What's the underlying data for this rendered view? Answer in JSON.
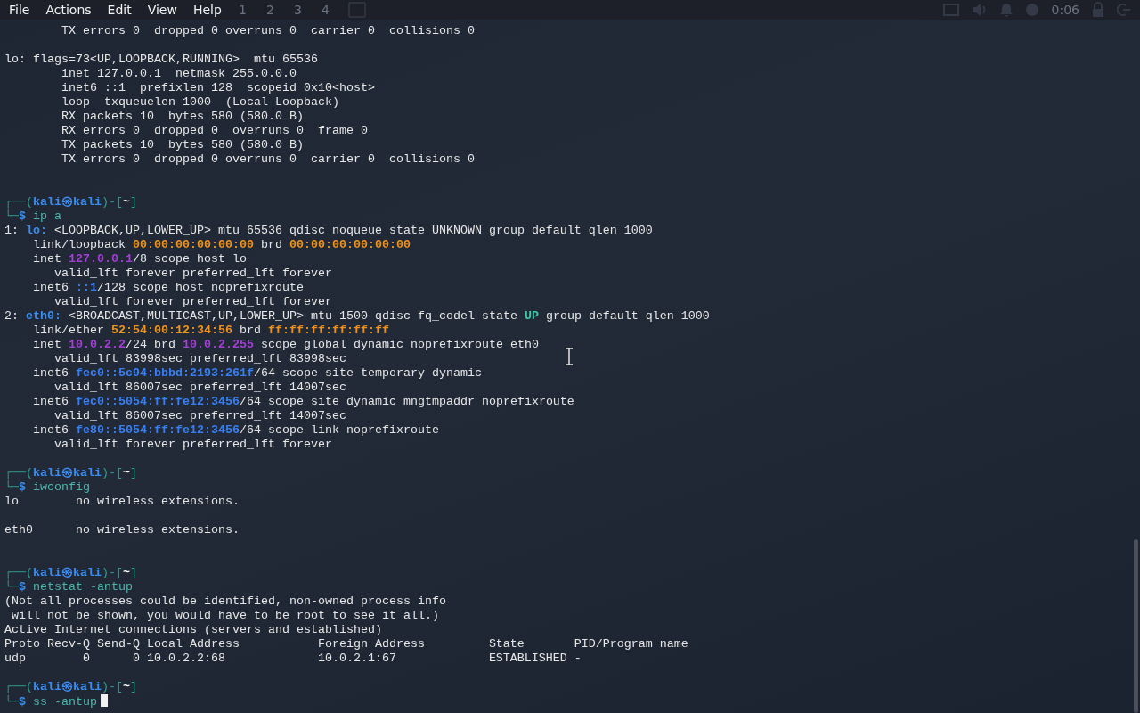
{
  "menu": [
    "File",
    "Actions",
    "Edit",
    "View",
    "Help"
  ],
  "panel": {
    "workspaces": [
      "1",
      "2",
      "3",
      "4"
    ],
    "clock": "0:06"
  },
  "terminal": {
    "lines": [
      {
        "segments": [
          {
            "kind": "plain",
            "text": "        TX errors 0  dropped 0 overruns 0  carrier 0  collisions 0"
          }
        ]
      },
      {
        "kind": "blank"
      },
      {
        "segments": [
          {
            "kind": "plain",
            "text": "lo: flags=73<UP,LOOPBACK,RUNNING>  mtu 65536"
          }
        ]
      },
      {
        "segments": [
          {
            "kind": "plain",
            "text": "        inet 127.0.0.1  netmask 255.0.0.0"
          }
        ]
      },
      {
        "segments": [
          {
            "kind": "plain",
            "text": "        inet6 ::1  prefixlen 128  scopeid 0x10<host>"
          }
        ]
      },
      {
        "segments": [
          {
            "kind": "plain",
            "text": "        loop  txqueuelen 1000  (Local Loopback)"
          }
        ]
      },
      {
        "segments": [
          {
            "kind": "plain",
            "text": "        RX packets 10  bytes 580 (580.0 B)"
          }
        ]
      },
      {
        "segments": [
          {
            "kind": "plain",
            "text": "        RX errors 0  dropped 0  overruns 0  frame 0"
          }
        ]
      },
      {
        "segments": [
          {
            "kind": "plain",
            "text": "        TX packets 10  bytes 580 (580.0 B)"
          }
        ]
      },
      {
        "segments": [
          {
            "kind": "plain",
            "text": "        TX errors 0  dropped 0 overruns 0  carrier 0  collisions 0"
          }
        ]
      },
      {
        "kind": "blank"
      },
      {
        "kind": "blank"
      },
      {
        "segments": [
          {
            "kind": "frame",
            "text": "┌──("
          },
          {
            "kind": "user",
            "text": "kali㉿kali"
          },
          {
            "kind": "frame",
            "text": ")-["
          },
          {
            "kind": "dir",
            "text": "~"
          },
          {
            "kind": "frame",
            "text": "]"
          }
        ]
      },
      {
        "segments": [
          {
            "kind": "frame",
            "text": "└─"
          },
          {
            "kind": "user",
            "text": "$"
          },
          {
            "kind": "command",
            "text": " ip a"
          }
        ]
      },
      {
        "segments": [
          {
            "kind": "plain",
            "text": "1: "
          },
          {
            "kind": "iface",
            "text": "lo:"
          },
          {
            "kind": "plain",
            "text": " <LOOPBACK,UP,LOWER_UP> mtu 65536 qdisc noqueue state UNKNOWN group default qlen 1000"
          }
        ]
      },
      {
        "segments": [
          {
            "kind": "plain",
            "text": "    link/loopback "
          },
          {
            "kind": "mac",
            "text": "00:00:00:00:00:00"
          },
          {
            "kind": "plain",
            "text": " brd "
          },
          {
            "kind": "mac",
            "text": "00:00:00:00:00:00"
          }
        ]
      },
      {
        "segments": [
          {
            "kind": "plain",
            "text": "    inet "
          },
          {
            "kind": "ipv4",
            "text": "127.0.0.1"
          },
          {
            "kind": "plain",
            "text": "/8 scope host lo"
          }
        ]
      },
      {
        "segments": [
          {
            "kind": "plain",
            "text": "       valid_lft forever preferred_lft forever"
          }
        ]
      },
      {
        "segments": [
          {
            "kind": "plain",
            "text": "    inet6 "
          },
          {
            "kind": "ipv6",
            "text": "::1"
          },
          {
            "kind": "plain",
            "text": "/128 scope host noprefixroute"
          }
        ]
      },
      {
        "segments": [
          {
            "kind": "plain",
            "text": "       valid_lft forever preferred_lft forever"
          }
        ]
      },
      {
        "segments": [
          {
            "kind": "plain",
            "text": "2: "
          },
          {
            "kind": "iface",
            "text": "eth0:"
          },
          {
            "kind": "plain",
            "text": " <BROADCAST,MULTICAST,UP,LOWER_UP> mtu 1500 qdisc fq_codel state "
          },
          {
            "kind": "up",
            "text": "UP"
          },
          {
            "kind": "plain",
            "text": " group default qlen 1000"
          }
        ]
      },
      {
        "segments": [
          {
            "kind": "plain",
            "text": "    link/ether "
          },
          {
            "kind": "mac",
            "text": "52:54:00:12:34:56"
          },
          {
            "kind": "plain",
            "text": " brd "
          },
          {
            "kind": "mac",
            "text": "ff:ff:ff:ff:ff:ff"
          }
        ]
      },
      {
        "segments": [
          {
            "kind": "plain",
            "text": "    inet "
          },
          {
            "kind": "ipv4",
            "text": "10.0.2.2"
          },
          {
            "kind": "plain",
            "text": "/24 brd "
          },
          {
            "kind": "ipv4",
            "text": "10.0.2.255"
          },
          {
            "kind": "plain",
            "text": " scope global dynamic noprefixroute eth0"
          }
        ]
      },
      {
        "segments": [
          {
            "kind": "plain",
            "text": "       valid_lft 83998sec preferred_lft 83998sec"
          }
        ]
      },
      {
        "segments": [
          {
            "kind": "plain",
            "text": "    inet6 "
          },
          {
            "kind": "ipv6",
            "text": "fec0::5c94:bbbd:2193:261f"
          },
          {
            "kind": "plain",
            "text": "/64 scope site temporary dynamic"
          }
        ]
      },
      {
        "segments": [
          {
            "kind": "plain",
            "text": "       valid_lft 86007sec preferred_lft 14007sec"
          }
        ]
      },
      {
        "segments": [
          {
            "kind": "plain",
            "text": "    inet6 "
          },
          {
            "kind": "ipv6",
            "text": "fec0::5054:ff:fe12:3456"
          },
          {
            "kind": "plain",
            "text": "/64 scope site dynamic mngtmpaddr noprefixroute"
          }
        ]
      },
      {
        "segments": [
          {
            "kind": "plain",
            "text": "       valid_lft 86007sec preferred_lft 14007sec"
          }
        ]
      },
      {
        "segments": [
          {
            "kind": "plain",
            "text": "    inet6 "
          },
          {
            "kind": "ipv6",
            "text": "fe80::5054:ff:fe12:3456"
          },
          {
            "kind": "plain",
            "text": "/64 scope link noprefixroute"
          }
        ]
      },
      {
        "segments": [
          {
            "kind": "plain",
            "text": "       valid_lft forever preferred_lft forever"
          }
        ]
      },
      {
        "kind": "blank"
      },
      {
        "segments": [
          {
            "kind": "frame",
            "text": "┌──("
          },
          {
            "kind": "user",
            "text": "kali㉿kali"
          },
          {
            "kind": "frame",
            "text": ")-["
          },
          {
            "kind": "dir",
            "text": "~"
          },
          {
            "kind": "frame",
            "text": "]"
          }
        ]
      },
      {
        "segments": [
          {
            "kind": "frame",
            "text": "└─"
          },
          {
            "kind": "user",
            "text": "$"
          },
          {
            "kind": "command",
            "text": " iwconfig"
          }
        ]
      },
      {
        "segments": [
          {
            "kind": "plain",
            "text": "lo        no wireless extensions."
          }
        ]
      },
      {
        "kind": "blank"
      },
      {
        "segments": [
          {
            "kind": "plain",
            "text": "eth0      no wireless extensions."
          }
        ]
      },
      {
        "kind": "blank"
      },
      {
        "kind": "blank"
      },
      {
        "segments": [
          {
            "kind": "frame",
            "text": "┌──("
          },
          {
            "kind": "user",
            "text": "kali㉿kali"
          },
          {
            "kind": "frame",
            "text": ")-["
          },
          {
            "kind": "dir",
            "text": "~"
          },
          {
            "kind": "frame",
            "text": "]"
          }
        ]
      },
      {
        "segments": [
          {
            "kind": "frame",
            "text": "└─"
          },
          {
            "kind": "user",
            "text": "$"
          },
          {
            "kind": "command",
            "text": " netstat -antup"
          }
        ]
      },
      {
        "segments": [
          {
            "kind": "plain",
            "text": "(Not all processes could be identified, non-owned process info"
          }
        ]
      },
      {
        "segments": [
          {
            "kind": "plain",
            "text": " will not be shown, you would have to be root to see it all.)"
          }
        ]
      },
      {
        "segments": [
          {
            "kind": "plain",
            "text": "Active Internet connections (servers and established)"
          }
        ]
      },
      {
        "segments": [
          {
            "kind": "plain",
            "text": "Proto Recv-Q Send-Q Local Address           Foreign Address         State       PID/Program name"
          }
        ]
      },
      {
        "segments": [
          {
            "kind": "plain",
            "text": "udp        0      0 10.0.2.2:68             10.0.2.1:67             ESTABLISHED -"
          }
        ]
      },
      {
        "kind": "blank"
      },
      {
        "segments": [
          {
            "kind": "frame",
            "text": "┌──("
          },
          {
            "kind": "user",
            "text": "kali㉿kali"
          },
          {
            "kind": "frame",
            "text": ")-["
          },
          {
            "kind": "dir",
            "text": "~"
          },
          {
            "kind": "frame",
            "text": "]"
          }
        ]
      },
      {
        "segments": [
          {
            "kind": "frame",
            "text": "└─"
          },
          {
            "kind": "user",
            "text": "$"
          },
          {
            "kind": "command",
            "text": " ss -antup"
          }
        ],
        "cursor": true
      }
    ]
  }
}
